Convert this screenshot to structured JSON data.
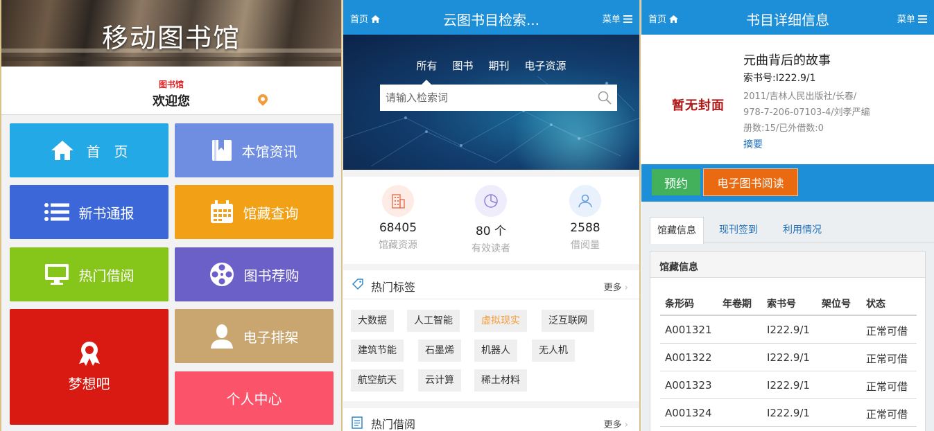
{
  "library_app": {
    "title": "移动图书馆",
    "welcome_label": "图书馆",
    "welcome_text": "欢迎您",
    "tiles": [
      {
        "label": "首　页",
        "color": "#22a9e6",
        "icon": "home-icon"
      },
      {
        "label": "本馆资讯",
        "color": "#6f8ee2",
        "icon": "bookmark-book-icon"
      },
      {
        "label": "新书通报",
        "color": "#3b67d8",
        "icon": "list-icon"
      },
      {
        "label": "馆藏查询",
        "color": "#f2a116",
        "icon": "calendar-icon"
      },
      {
        "label": "热门借阅",
        "color": "#86c51a",
        "icon": "monitor-icon"
      },
      {
        "label": "图书荐购",
        "color": "#6b5fc8",
        "icon": "film-reel-icon"
      },
      {
        "label": "梦想吧",
        "color": "#d91a12",
        "icon": "award-ribbon-icon"
      },
      {
        "label": "电子排架",
        "color": "#c9a66f",
        "icon": "person-icon"
      },
      {
        "label": "个人中心",
        "color": "#fb536a",
        "icon": ""
      }
    ]
  },
  "search_app": {
    "home": "首页",
    "title": "云图书目检索...",
    "menu": "菜单",
    "tabs": [
      "所有",
      "图书",
      "期刊",
      "电子资源"
    ],
    "search_placeholder": "请输入检索词",
    "stats": [
      {
        "value": "68405",
        "label": "馆藏资源",
        "icon": "building-icon",
        "color": "#e8785a",
        "bg": "#fdece6"
      },
      {
        "value": "80 个",
        "label": "有效读者",
        "icon": "pie-chart-icon",
        "color": "#8e7ed8",
        "bg": "#efecfb"
      },
      {
        "value": "2588",
        "label": "借阅量",
        "icon": "users-icon",
        "color": "#5e9be0",
        "bg": "#e8f1fc"
      }
    ],
    "hot_tags_title": "热门标签",
    "more": "更多",
    "tags": [
      "大数据",
      "人工智能",
      "虚拟现实",
      "泛互联网",
      "建筑节能",
      "石墨烯",
      "机器人",
      "无人机",
      "航空航天",
      "云计算",
      "稀土材料"
    ],
    "hot_borrow_title": "热门借阅"
  },
  "detail_app": {
    "home": "首页",
    "title": "书目详细信息",
    "menu": "菜单",
    "cover_text": "暂无封面",
    "book_title": "元曲背后的故事",
    "call_number": "索书号:I222.9/1",
    "pub_line1": "2011/吉林人民出版社/长春/",
    "pub_line2": "978-7-206-07103-4/刘孝严编",
    "copies": "册数:15/已外借数:0",
    "abstract_link": "摘要",
    "reserve_button": "预约",
    "ebook_button": "电子图书阅读",
    "tabs": [
      "馆藏信息",
      "现刊签到",
      "利用情况"
    ],
    "holdings_title": "馆藏信息",
    "columns": [
      "条形码",
      "年卷期",
      "索书号",
      "架位号",
      "状态"
    ],
    "rows": [
      [
        "A001321",
        "",
        "I222.9/1",
        "",
        "正常可借"
      ],
      [
        "A001322",
        "",
        "I222.9/1",
        "",
        "正常可借"
      ],
      [
        "A001323",
        "",
        "I222.9/1",
        "",
        "正常可借"
      ],
      [
        "A001324",
        "",
        "I222.9/1",
        "",
        "正常可借"
      ]
    ]
  }
}
